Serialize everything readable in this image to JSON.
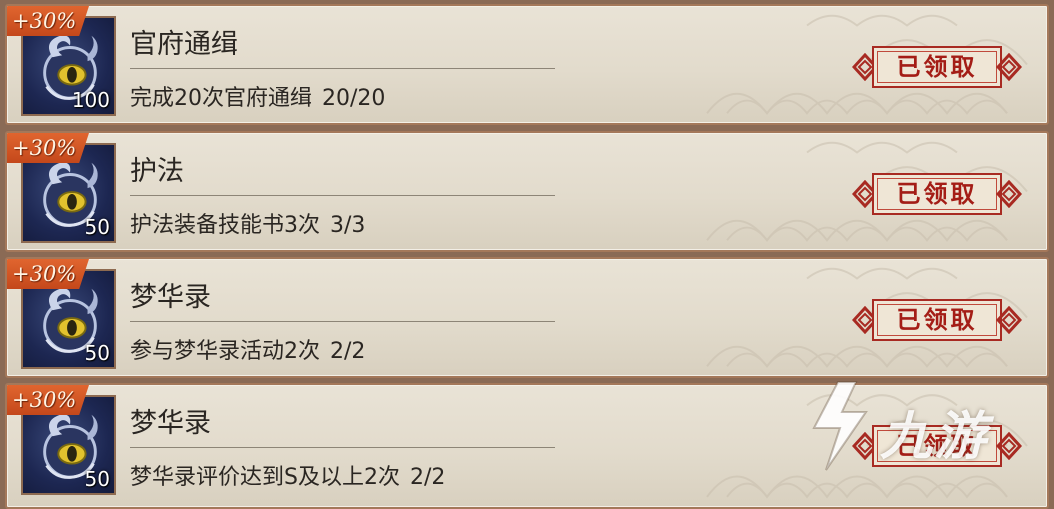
{
  "tasks": [
    {
      "bonus": "+30%",
      "count": "100",
      "title": "官府通缉",
      "desc": "完成20次官府通缉",
      "progress": "20/20",
      "button": "已领取"
    },
    {
      "bonus": "+30%",
      "count": "50",
      "title": "护法",
      "desc": "护法装备技能书3次",
      "progress": "3/3",
      "button": "已领取"
    },
    {
      "bonus": "+30%",
      "count": "50",
      "title": "梦华录",
      "desc": "参与梦华录活动2次",
      "progress": "2/2",
      "button": "已领取"
    },
    {
      "bonus": "+30%",
      "count": "50",
      "title": "梦华录",
      "desc": "梦华录评价达到S及以上2次",
      "progress": "2/2",
      "button": "已领取"
    }
  ],
  "watermark": {
    "text": "九游"
  },
  "colors": {
    "row_bg": "#e2dbcc",
    "border": "#a4785a",
    "bonus_tag": "#d2541f",
    "claim_red": "#a41d16",
    "item_bg": "#1d2752"
  },
  "icons": {
    "item": "spirit-orb-icon",
    "button_ornament": "chinese-knot-icon",
    "watermark": "jiuyou-logo-icon"
  }
}
